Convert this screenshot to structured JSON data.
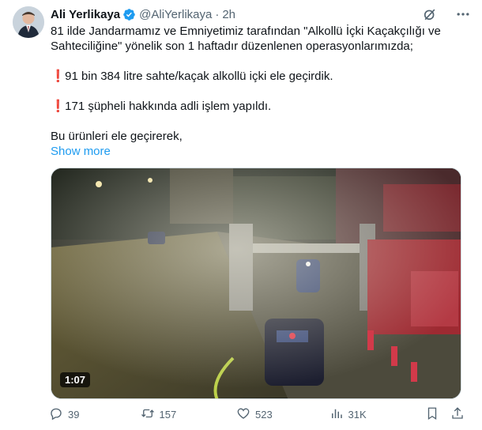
{
  "author": {
    "name": "Ali Yerlikaya",
    "handle": "@AliYerlikaya",
    "separator": "·",
    "time": "2h"
  },
  "tweet": {
    "line1": "81 ilde Jandarmamız ve Emniyetimiz tarafından \"Alkollü İçki Kaçakçılığı ve",
    "line2": "Sahteciliğine\" yönelik son 1 haftadır düzenlenen operasyonlarımızda;",
    "excl_glyph": "❗",
    "bullet1": "91  bin 384 litre sahte/kaçak alkollü içki ele geçirdik.",
    "bullet2": "171 şüpheli hakkında adli işlem yapıldı.",
    "line_last": "Bu ürünleri ele geçirerek,",
    "show_more": "Show more"
  },
  "media": {
    "duration": "1:07"
  },
  "actions": {
    "replies": "39",
    "reposts": "157",
    "likes": "523",
    "views": "31K"
  },
  "icons": [
    "verified-badge-icon",
    "grok-icon",
    "more-icon",
    "reply-icon",
    "repost-icon",
    "like-icon",
    "views-icon",
    "bookmark-icon",
    "share-icon"
  ],
  "colors": {
    "link": "#1d9bf0",
    "text": "#0f1419",
    "secondary": "#536471",
    "verified": "#1d9bf0",
    "excl": "#e0245e"
  }
}
